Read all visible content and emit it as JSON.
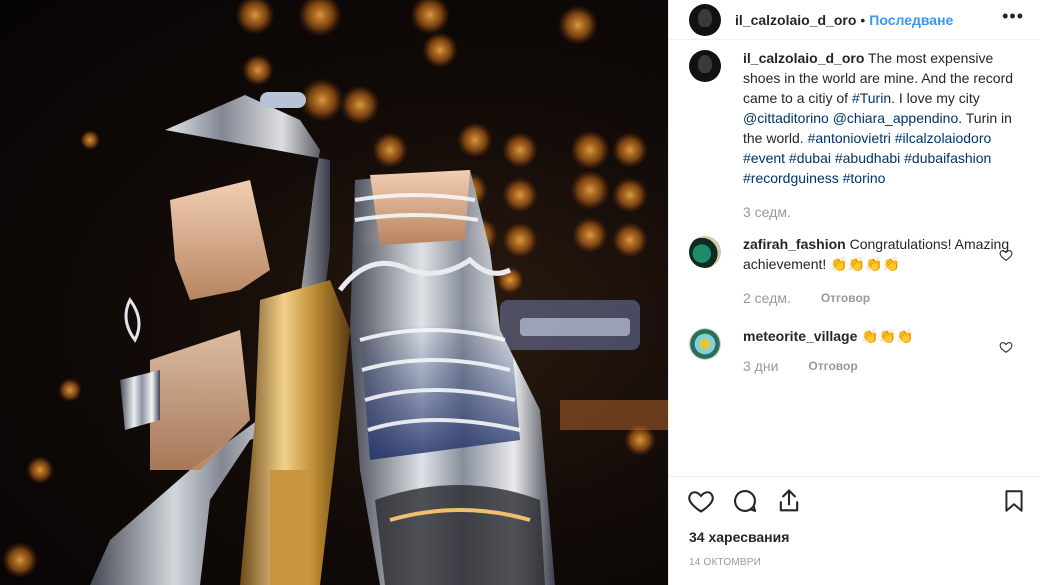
{
  "header": {
    "username": "il_calzolaio_d_oro",
    "separator": "•",
    "follow_label": "Последване",
    "more_icon": "more-options-icon"
  },
  "caption": {
    "username": "il_calzolaio_d_oro",
    "text_1": " The most expensive shoes in the world are mine. And the record came to a citiy of ",
    "tag_turin": "#Turin",
    "text_2": ". I love my city ",
    "mention_1": "@cittaditorino",
    "mention_2": "@chiara_appendino",
    "text_3": ". Turin in the world. ",
    "hashtags": "#antoniovietri #ilcalzolaiodoro #event #dubai #abudhabi #dubaifashion #recordguiness #torino",
    "time": "3 седм."
  },
  "comments": [
    {
      "username": "zafirah_fashion",
      "text": "Congratulations! Amazing achievement! 👏👏👏👏",
      "time": "2 седм.",
      "reply_label": "Отговор"
    },
    {
      "username": "meteorite_village",
      "text": "👏👏👏",
      "time": "3 дни",
      "reply_label": "Отговор"
    }
  ],
  "footer": {
    "likes": "34 харесвания",
    "date": "14 ОКТОМВРИ"
  },
  "icons": {
    "like": "heart-icon",
    "comment": "comment-icon",
    "share": "share-icon",
    "save": "bookmark-icon"
  },
  "colors": {
    "accent": "#3897f0",
    "tag": "#003569",
    "muted": "#999999"
  }
}
